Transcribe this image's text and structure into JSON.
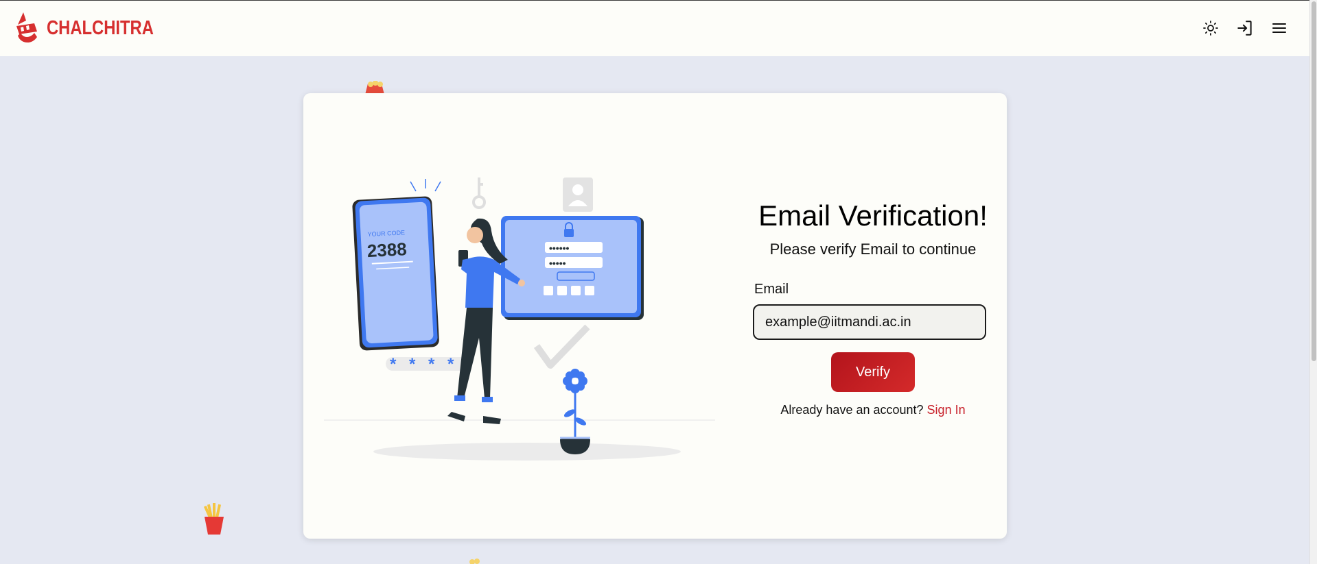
{
  "brand": {
    "name": "CHALCHITRA"
  },
  "header": {
    "icons": [
      "sun-icon",
      "sign-in-icon",
      "menu-icon"
    ]
  },
  "illustration": {
    "code_label": "YOUR CODE",
    "code_value": "2388",
    "password_mask_1": "••••••",
    "password_mask_2": "•••••",
    "pin_mask": "* * * *"
  },
  "form": {
    "title": "Email Verification!",
    "subtitle": "Please verify Email to continue",
    "email_label": "Email",
    "email_value": "example@iitmandi.ac.in",
    "verify_label": "Verify",
    "account_prompt": "Already have an account? ",
    "signin_label": "Sign In"
  },
  "colors": {
    "brand_red": "#d62f2f",
    "button_red": "#c01d23",
    "page_bg": "#e5e8f2",
    "card_bg": "#fdfdf9",
    "illustration_blue": "#3f78f0"
  }
}
